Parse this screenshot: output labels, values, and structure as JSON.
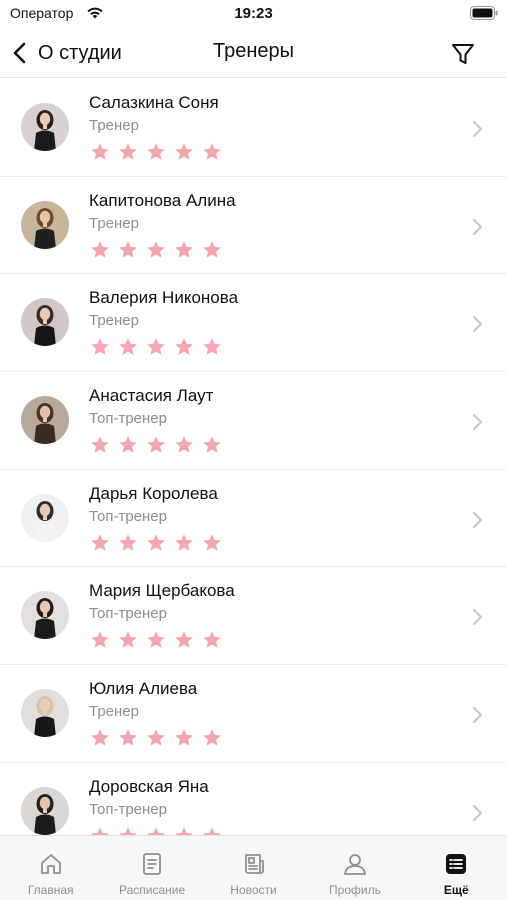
{
  "status_bar": {
    "carrier": "Оператор",
    "time": "19:23"
  },
  "nav": {
    "back_label": "О студии",
    "title": "Тренеры"
  },
  "colors": {
    "star": "#f4a7ae",
    "chevron": "#c7c7cc",
    "tab_inactive": "#8e8e93",
    "tab_active": "#111111"
  },
  "trainers": [
    {
      "name": "Салазкина Соня",
      "role": "Тренер",
      "rating": 5
    },
    {
      "name": "Капитонова Алина",
      "role": "Тренер",
      "rating": 5
    },
    {
      "name": "Валерия Никонова",
      "role": "Тренер",
      "rating": 5
    },
    {
      "name": "Анастасия Лаут",
      "role": "Топ-тренер",
      "rating": 5
    },
    {
      "name": "Дарья Королева",
      "role": "Топ-тренер",
      "rating": 5
    },
    {
      "name": "Мария Щербакова",
      "role": "Топ-тренер",
      "rating": 5
    },
    {
      "name": "Юлия Алиева",
      "role": "Тренер",
      "rating": 5
    },
    {
      "name": "Доровская Яна",
      "role": "Топ-тренер",
      "rating": 5
    }
  ],
  "tabs": [
    {
      "label": "Главная",
      "icon": "home-icon"
    },
    {
      "label": "Расписание",
      "icon": "schedule-icon"
    },
    {
      "label": "Новости",
      "icon": "news-icon"
    },
    {
      "label": "Профиль",
      "icon": "profile-icon"
    },
    {
      "label": "Ещё",
      "icon": "more-icon",
      "active": true
    }
  ]
}
